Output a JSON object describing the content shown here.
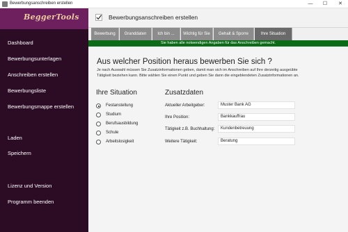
{
  "window": {
    "title": "Bewerbungsanschreiben erstellen",
    "minimize_glyph": "—",
    "maximize_glyph": "☐",
    "close_glyph": "✕"
  },
  "sidebar": {
    "logo": "BeggerTools",
    "items": [
      {
        "label": "Dashboard"
      },
      {
        "label": "Bewerbungsunterlagen"
      },
      {
        "label": "Anschreiben erstellen"
      },
      {
        "label": "Bewerbungsliste"
      },
      {
        "label": "Bewerbungsmappe erstellen"
      },
      {
        "label": "Laden"
      },
      {
        "label": "Speichern"
      },
      {
        "label": "Lizenz und Version"
      },
      {
        "label": "Programm beenden"
      }
    ]
  },
  "header": {
    "icon": "checkmark-icon",
    "title": "Bewerbungsanschreiben erstellen"
  },
  "tabs": [
    {
      "label": "Bewerbung"
    },
    {
      "label": "Granddaten"
    },
    {
      "label": "Ich bin ..."
    },
    {
      "label": "Wichtig für Sie"
    },
    {
      "label": "Gehalt & Sporre"
    },
    {
      "label": "Ihre Situation"
    }
  ],
  "active_tab": "Ihre Situation",
  "notice": "Sie haben alle notwendigen Angaben für das Anschreiben gemacht.",
  "content": {
    "heading": "Aus welcher Position heraus bewerben Sie sich ?",
    "intro": "Je nach Auswahl müssen Sie Zusatzinformationen geben, damit man sich im Anschreiben auf Ihre derzeitig ausgeübte Tätigkeit beziehen kann. Bitte wählen Sie einen Punkt und geben Sie dann die eingeblendeten Zusatzinformationen an.",
    "situation": {
      "title": "Ihre Situation",
      "options": [
        {
          "label": "Festanstellung",
          "checked": true
        },
        {
          "label": "Studium",
          "checked": false
        },
        {
          "label": "Berufsausbildung",
          "checked": false
        },
        {
          "label": "Schule",
          "checked": false
        },
        {
          "label": "Arbeitslosigkeit",
          "checked": false
        }
      ]
    },
    "zusatz": {
      "title": "Zusatzdaten",
      "fields": [
        {
          "label": "Aktueller Arbeitgeber:",
          "value": "Muster Bank AG"
        },
        {
          "label": "Ihre Position:",
          "value": "Bankkauffrau"
        },
        {
          "label": "Tätigkeit z.B. Buchhaltung:",
          "value": "Kundenbetreuung"
        },
        {
          "label": "Weitere Tätigkeit:",
          "value": "Beratung"
        }
      ]
    }
  },
  "colors": {
    "sidebar_bg": "#2c0b24",
    "logo_strip": "#6e1f5e",
    "tab_bg": "#8c8c8c",
    "notice_bg": "#0b6b16"
  }
}
